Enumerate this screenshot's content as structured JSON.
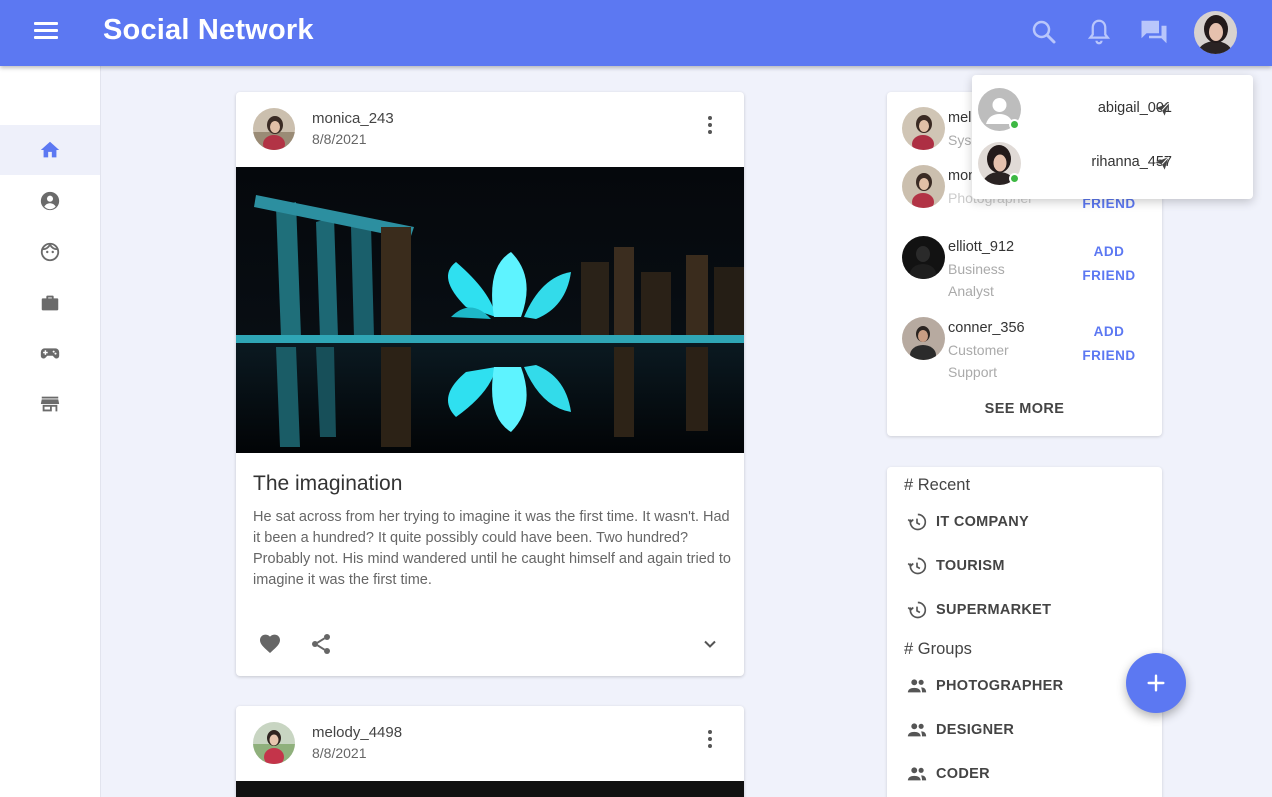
{
  "appbar": {
    "title": "Social Network",
    "icons": [
      "menu-icon",
      "search-icon",
      "bell-icon",
      "chat-icon"
    ]
  },
  "sidebar": {
    "items": [
      {
        "icon": "home-icon",
        "active": true
      },
      {
        "icon": "account-circle-icon",
        "active": false
      },
      {
        "icon": "face-icon",
        "active": false
      },
      {
        "icon": "briefcase-icon",
        "active": false
      },
      {
        "icon": "gamepad-icon",
        "active": false
      },
      {
        "icon": "store-icon",
        "active": false
      }
    ]
  },
  "posts": [
    {
      "user": "monica_243",
      "date": "8/8/2021",
      "title": "The imagination",
      "body": "He sat across from her trying to imagine it was the first time. It wasn't. Had it been a hundred? It quite possibly could have been. Two hundred? Probably not. His mind wandered until he caught himself and again tried to imagine it was the first time."
    },
    {
      "user": "melody_4498",
      "date": "8/8/2021"
    }
  ],
  "suggestions": {
    "items": [
      {
        "name": "mel",
        "role": "Sys"
      },
      {
        "name": "mon",
        "role": "Photographer",
        "action": "FRIEND"
      },
      {
        "name": "elliott_912",
        "role_line1": "Business",
        "role_line2": "Analyst",
        "action_line1": "ADD",
        "action_line2": "FRIEND"
      },
      {
        "name": "conner_356",
        "role_line1": "Customer",
        "role_line2": "Support",
        "action_line1": "ADD",
        "action_line2": "FRIEND"
      }
    ],
    "see_more": "SEE MORE"
  },
  "topics": {
    "recent_header": "# Recent",
    "recent": [
      "IT COMPANY",
      "TOURISM",
      "SUPERMARKET"
    ],
    "groups_header": "# Groups",
    "groups": [
      "PHOTOGRAPHER",
      "DESIGNER",
      "CODER"
    ]
  },
  "messages_popup": {
    "contacts": [
      {
        "name": "abigail_001",
        "online": true
      },
      {
        "name": "rihanna_457",
        "online": true
      }
    ]
  },
  "colors": {
    "primary": "#5c78f2",
    "online": "#3db843",
    "background": "#f0f2fb"
  }
}
